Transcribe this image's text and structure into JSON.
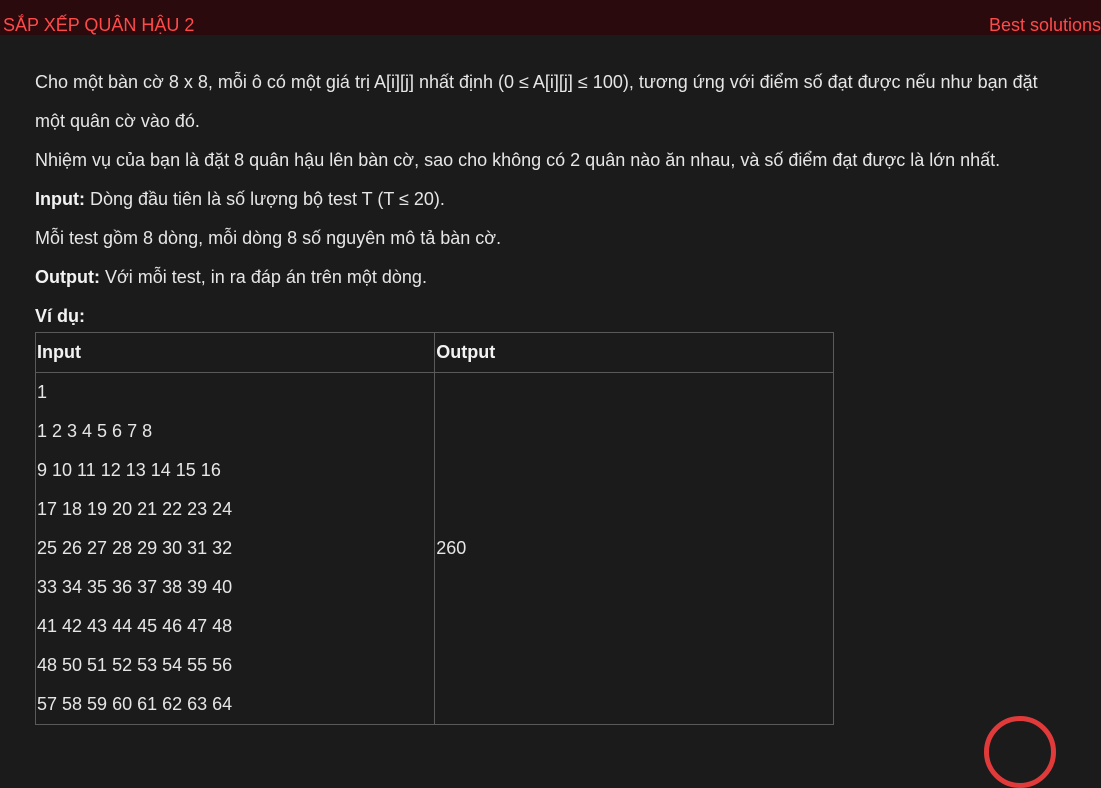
{
  "header": {
    "title": "SẮP XẾP QUÂN HẬU 2",
    "best_solutions": "Best solutions"
  },
  "problem": {
    "desc_line1": "Cho một bàn cờ 8 x 8, mỗi ô có một giá trị A[i][j] nhất định (0 ≤ A[i][j] ≤ 100), tương ứng với điểm số đạt được nếu như bạn đặt",
    "desc_line2": "một quân cờ vào đó.",
    "task": "Nhiệm vụ của bạn là đặt 8 quân hậu lên bàn cờ, sao cho không có 2 quân nào ăn nhau, và số điểm đạt được là lớn nhất.",
    "input_label": "Input:",
    "input_text": " Dòng đầu tiên là số lượng bộ test T (T ≤ 20).",
    "input_text2": "Mỗi test gồm 8 dòng, mỗi dòng 8 số nguyên mô tả bàn cờ.",
    "output_label": "Output:",
    "output_text": "  Với mỗi test, in ra đáp án trên một dòng.",
    "example_label": "Ví dụ:"
  },
  "example": {
    "headers": [
      "Input",
      "Output"
    ],
    "input_lines": [
      "1",
      "1 2 3 4 5 6 7 8",
      "9 10 11 12 13 14 15 16",
      "17 18 19 20 21 22 23 24",
      "25 26 27 28 29 30 31 32",
      "33 34 35 36 37 38 39 40",
      "41 42 43 44 45 46 47 48",
      "48 50 51 52 53 54 55 56",
      "57 58 59 60 61 62 63 64"
    ],
    "output": "260"
  },
  "colors": {
    "accent": "#ff4a4a",
    "topbar": "#2a0a0d",
    "background": "#1b1b1b",
    "text": "#e6e6e6",
    "border": "#5a5a5a"
  }
}
